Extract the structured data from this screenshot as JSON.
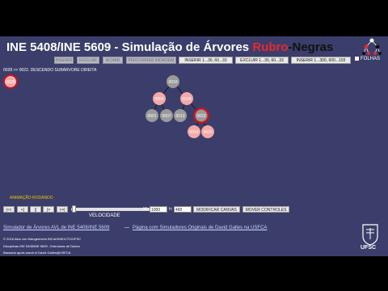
{
  "app": {
    "title_a": "INE 5408/INE 5609 - Simulação de Árvores ",
    "title_red": "Rubro",
    "title_black": "-Negras",
    "leaves_label": "FOLHAS"
  },
  "toolbar": {
    "buttons": [
      {
        "label": "INSERIR",
        "enabled": false
      },
      {
        "label": "EXCLUIR",
        "enabled": false
      },
      {
        "label": "ACHAR",
        "enabled": false
      },
      {
        "label": "PERCORRER INORDEM",
        "enabled": false
      },
      {
        "label": "INSERIR 1...30, 60...33",
        "enabled": true
      },
      {
        "label": "EXCLUIR 1...30, 60...33",
        "enabled": true
      },
      {
        "label": "INSERIR 1...300, 600...103",
        "enabled": true
      }
    ]
  },
  "status": "0028 >> 0022. DESCENDO SUBÁRVORE DIREITA",
  "tree": {
    "floating_node": {
      "label": "0028",
      "color": "red"
    },
    "nodes": [
      {
        "label": "0010",
        "color": "black"
      },
      {
        "label": "0004",
        "color": "red"
      },
      {
        "label": "0016",
        "color": "red"
      },
      {
        "label": "0001",
        "color": "black"
      },
      {
        "label": "0007",
        "color": "black"
      },
      {
        "label": "0013",
        "color": "black"
      },
      {
        "label": "0022",
        "color": "black",
        "highlighted": true
      },
      {
        "label": "0019",
        "color": "red"
      },
      {
        "label": "0025",
        "color": "red"
      }
    ]
  },
  "animation": {
    "status_label": "ANIMAÇÃO RODANDO",
    "controls": [
      "|<<",
      "<|",
      "||",
      "|>",
      ">>|"
    ],
    "speed_label": "VELOCIDADE",
    "width_label": "W:",
    "width_value": "1000",
    "height_label": "h:",
    "height_value": "400",
    "modify_canvas": "MODIFICAR CANVAS",
    "move_controls": "MOVER CONTROLES"
  },
  "footer": {
    "link1": "Simulador de Árvores AVL de INE 5408/INE 5609",
    "separator": "—",
    "link2": "Página com Simuladores Originais de David Galles na USFCA",
    "line1": "© 2016 Aldo von Wangenheim INCoD/INE/CTC/UFSC",
    "line2": "Disciplinas INE 5408/INE 5609 - Estruturas de Dados",
    "line3": "Baseado apois wwob el David Galles@USFCA",
    "ufsc": "UFSC"
  },
  "colors": {
    "background": "#3b3e6a",
    "red_node": "#f4a8a8",
    "black_node": "#9a9a9a",
    "highlight": "#c8141e",
    "accent_yellow": "#f2c200"
  }
}
